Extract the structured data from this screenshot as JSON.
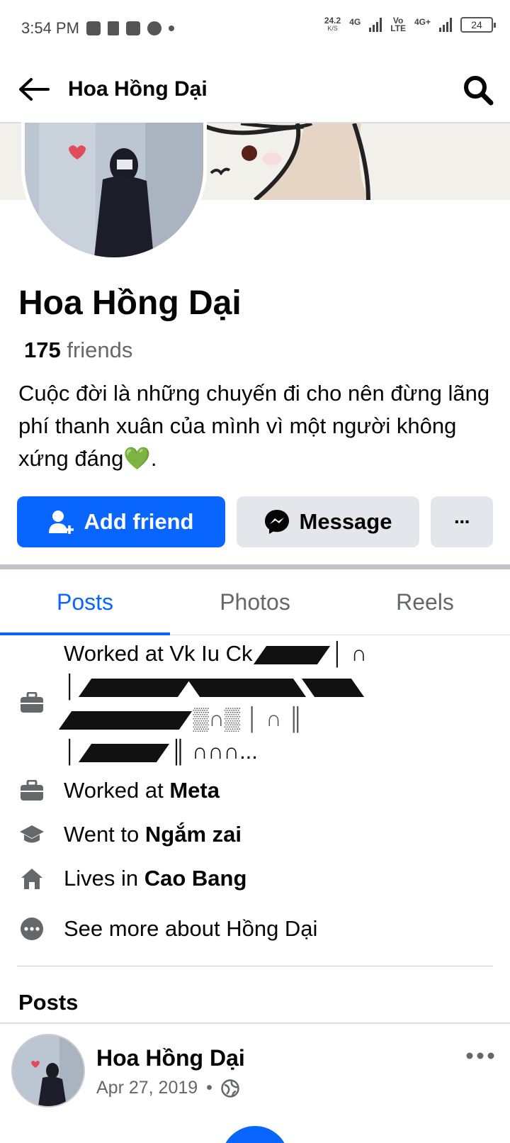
{
  "status_bar": {
    "time": "3:54 PM",
    "speed": "24.2",
    "speed_unit": "K/S",
    "net1": "4G",
    "net2": "Vo",
    "net2b": "LTE",
    "net3": "4G+",
    "battery": "24"
  },
  "header": {
    "title": "Hoa Hồng Dại"
  },
  "profile": {
    "name": "Hoa Hồng Dại",
    "friends_count": "175",
    "friends_label": "friends",
    "bio": "Cuộc đời là những chuyến đi cho nên đừng lãng phí thanh xuân của mình vì một người không xứng đáng💚."
  },
  "actions": {
    "add_friend": "Add friend",
    "message": "Message",
    "more": "···"
  },
  "tabs": [
    {
      "label": "Posts",
      "active": true
    },
    {
      "label": "Photos",
      "active": false
    },
    {
      "label": "Reels",
      "active": false
    }
  ],
  "intro": {
    "work1_prefix": "Worked at Vk Iu Ck",
    "work1_end": "∩∩∩...",
    "work2_prefix": "Worked at",
    "work2_value": "Meta",
    "edu_prefix": "Went to",
    "edu_value": "Ngắm zai",
    "home_prefix": "Lives in",
    "home_value": "Cao Bang",
    "see_more": "See more about Hồng Dại"
  },
  "posts_section": {
    "heading": "Posts"
  },
  "post": {
    "author": "Hoa Hồng Dại",
    "date": "Apr 27, 2019",
    "separator": "•"
  },
  "colors": {
    "accent": "#0866ff",
    "secondary_button": "#e4e6eb",
    "muted_text": "#65676b"
  }
}
